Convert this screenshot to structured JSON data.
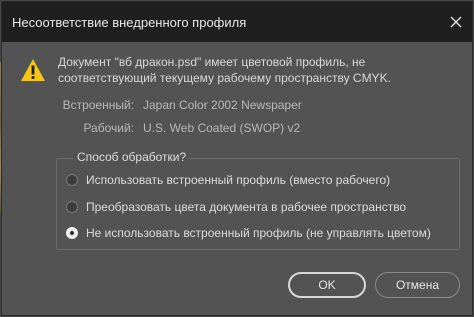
{
  "window": {
    "title": "Несоответствие внедренного профиля",
    "close_icon": "close-icon"
  },
  "message": {
    "icon": "warning-icon",
    "text": "Документ \"вб дракон.psd\" имеет цветовой профиль, не соответствующий текущему рабочему пространству CMYK."
  },
  "profiles": {
    "embedded_label": "Встроенный:",
    "embedded_value": "Japan Color 2002 Newspaper",
    "working_label": "Рабочий:",
    "working_value": "U.S. Web Coated (SWOP) v2"
  },
  "handling": {
    "legend": "Способ обработки?",
    "options": [
      {
        "label": "Использовать встроенный профиль (вместо рабочего)",
        "selected": false
      },
      {
        "label": "Преобразовать цвета документа в рабочее пространство",
        "selected": false
      },
      {
        "label": "Не использовать встроенный профиль (не управлять цветом)",
        "selected": true
      }
    ]
  },
  "buttons": {
    "ok_label": "OK",
    "cancel_label": "Отмена"
  },
  "colors": {
    "dialog_bg": "#535353",
    "titlebar_bg": "#1f1f1f",
    "warning_yellow": "#f5c518"
  }
}
